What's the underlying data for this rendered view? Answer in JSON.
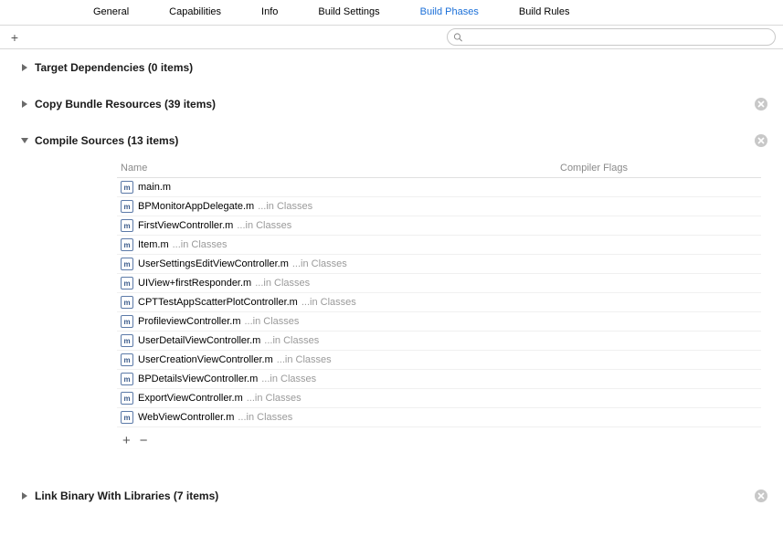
{
  "tabs": [
    {
      "label": "General",
      "active": false
    },
    {
      "label": "Capabilities",
      "active": false
    },
    {
      "label": "Info",
      "active": false
    },
    {
      "label": "Build Settings",
      "active": false
    },
    {
      "label": "Build Phases",
      "active": true
    },
    {
      "label": "Build Rules",
      "active": false
    }
  ],
  "search": {
    "placeholder": ""
  },
  "phases": {
    "target_deps": {
      "title": "Target Dependencies (0 items)",
      "expanded": false,
      "removable": false
    },
    "copy_bundle": {
      "title": "Copy Bundle Resources (39 items)",
      "expanded": false,
      "removable": true
    },
    "compile": {
      "title": "Compile Sources (13 items)",
      "expanded": true,
      "removable": true,
      "columns": {
        "name": "Name",
        "flags": "Compiler Flags"
      },
      "files": [
        {
          "name": "main.m",
          "path": ""
        },
        {
          "name": "BPMonitorAppDelegate.m",
          "path": "...in Classes"
        },
        {
          "name": "FirstViewController.m",
          "path": "...in Classes"
        },
        {
          "name": "Item.m",
          "path": "...in Classes"
        },
        {
          "name": "UserSettingsEditViewController.m",
          "path": "...in Classes"
        },
        {
          "name": "UIView+firstResponder.m",
          "path": "...in Classes"
        },
        {
          "name": "CPTTestAppScatterPlotController.m",
          "path": "...in Classes"
        },
        {
          "name": "ProfileviewController.m",
          "path": "...in Classes"
        },
        {
          "name": "UserDetailViewController.m",
          "path": "...in Classes"
        },
        {
          "name": "UserCreationViewController.m",
          "path": "...in Classes"
        },
        {
          "name": "BPDetailsViewController.m",
          "path": "...in Classes"
        },
        {
          "name": "ExportViewController.m",
          "path": "...in Classes"
        },
        {
          "name": "WebViewController.m",
          "path": "...in Classes"
        }
      ]
    },
    "link_binary": {
      "title": "Link Binary With Libraries (7 items)",
      "expanded": false,
      "removable": true
    }
  },
  "icons": {
    "file_letter": "m"
  }
}
